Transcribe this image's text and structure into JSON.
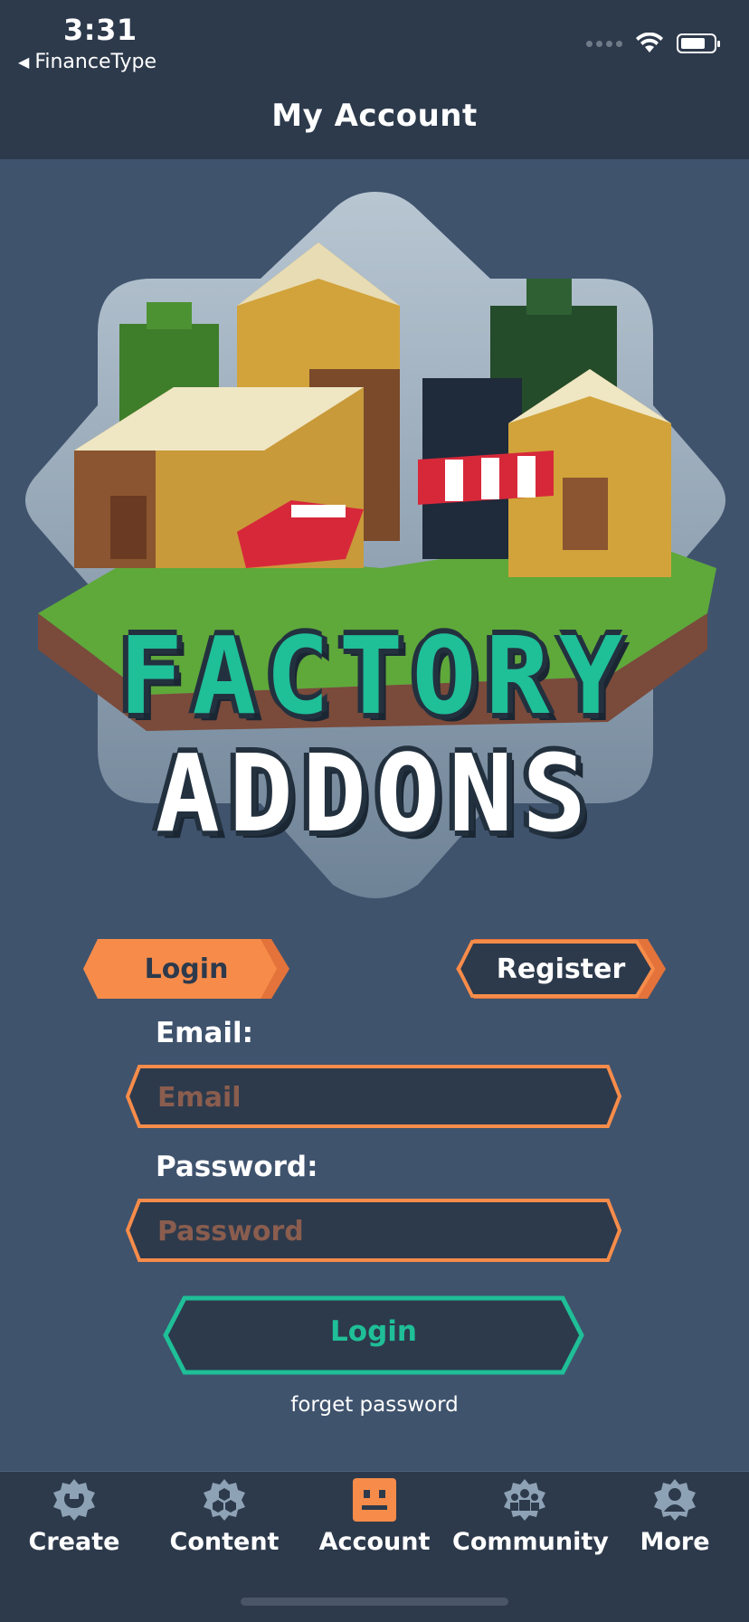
{
  "status_bar": {
    "time": "3:31",
    "back_app": "FinanceType",
    "back_arrow": "◀"
  },
  "header": {
    "title": "My Account"
  },
  "hero": {
    "logo_line1": "FACTORY",
    "logo_line2": "ADDONS"
  },
  "auth_tabs": {
    "login": "Login",
    "register": "Register",
    "active": "login"
  },
  "form": {
    "email_label": "Email:",
    "email_placeholder": "Email",
    "email_value": "",
    "password_label": "Password:",
    "password_placeholder": "Password",
    "password_value": "",
    "submit_label": "Login",
    "forgot_label": "forget password"
  },
  "tabbar": {
    "items": [
      {
        "label": "Create",
        "icon": "wrench-gear-icon"
      },
      {
        "label": "Content",
        "icon": "hex-grid-gear-icon"
      },
      {
        "label": "Account",
        "icon": "face-icon",
        "active": true
      },
      {
        "label": "Community",
        "icon": "people-gear-icon"
      },
      {
        "label": "More",
        "icon": "person-gear-icon"
      }
    ]
  },
  "colors": {
    "background": "#3f536d",
    "header": "#2d3a4c",
    "accent_orange": "#f78c4a",
    "accent_teal": "#1fbf98",
    "field_bg": "#2d3a4c",
    "placeholder": "#8a5d4e"
  }
}
